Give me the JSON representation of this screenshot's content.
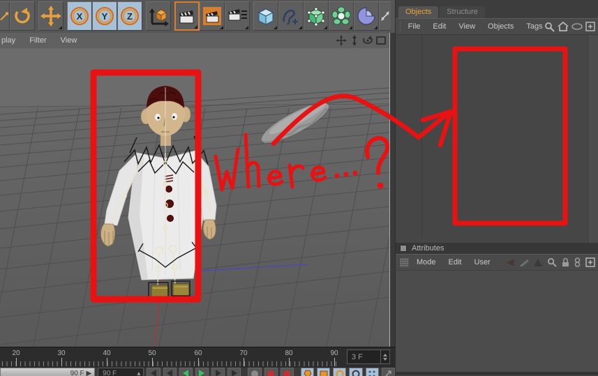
{
  "colors": {
    "annotation_red": "#e81212",
    "accent_orange": "#e8a23c"
  },
  "toolbar": {
    "axis_buttons": [
      "X",
      "Y",
      "Z"
    ]
  },
  "viewport": {
    "menu_items": [
      "play",
      "Filter",
      "View"
    ]
  },
  "objects_panel": {
    "tabs": [
      {
        "label": "Objects"
      },
      {
        "label": "Structure"
      }
    ],
    "menu_items": [
      "File",
      "Edit",
      "View",
      "Objects",
      "Tags"
    ]
  },
  "attributes_panel": {
    "title": "Attributes",
    "menu_items": [
      "Mode",
      "Edit",
      "User"
    ]
  },
  "timeline": {
    "ticks": [
      "20",
      "30",
      "40",
      "50",
      "60",
      "70",
      "80",
      "90"
    ],
    "frame_field": "3 F",
    "range_bar_label": "90 F",
    "range_dropdown_label": "90 F"
  },
  "annotation": {
    "where_text": "Where ...?"
  }
}
